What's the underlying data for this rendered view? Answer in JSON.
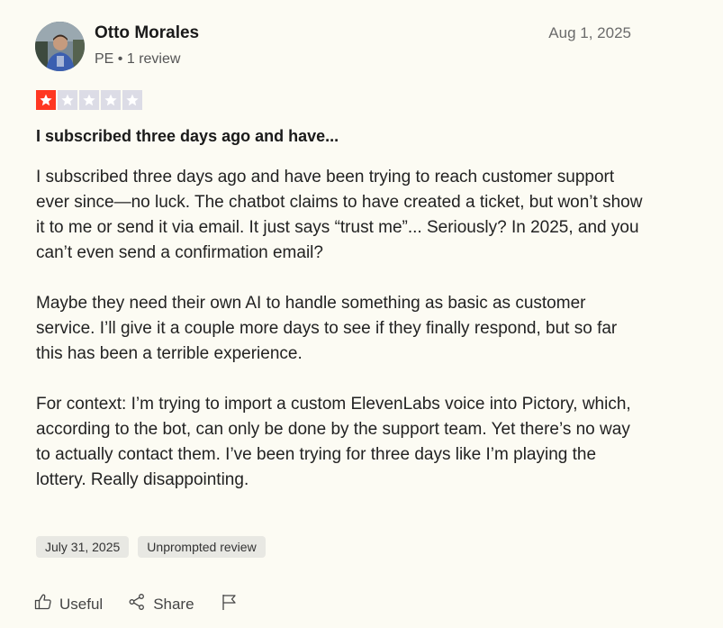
{
  "reviewer": {
    "name": "Otto Morales",
    "country": "PE",
    "separator": "•",
    "review_count": "1 review"
  },
  "review": {
    "date": "Aug 1, 2025",
    "rating": 1,
    "rating_max": 5,
    "title": "I subscribed three days ago and have...",
    "paragraphs": [
      "I subscribed three days ago and have been trying to reach customer support ever since—no luck. The chatbot claims to have created a ticket, but won’t show it to me or send it via email. It just says “trust me”... Seriously? In 2025, and you can’t even send a confirmation email?",
      "Maybe they need their own AI to handle something as basic as customer service. I’ll give it a couple more days to see if they finally respond, but so far this has been a terrible experience.",
      "For context: I’m trying to import a custom ElevenLabs voice into Pictory, which, according to the bot, can only be done by the support team. Yet there’s no way to actually contact them. I’ve been trying for three days like I’m playing the lottery. Really disappointing."
    ],
    "tags": [
      "July 31, 2025",
      "Unprompted review"
    ]
  },
  "actions": {
    "useful_label": "Useful",
    "share_label": "Share",
    "icons": [
      "thumbs-up-icon",
      "share-icon",
      "flag-icon"
    ]
  },
  "colors": {
    "star_filled": "#ff3722",
    "star_empty": "#dcdce6",
    "background": "#fcfbf3"
  }
}
